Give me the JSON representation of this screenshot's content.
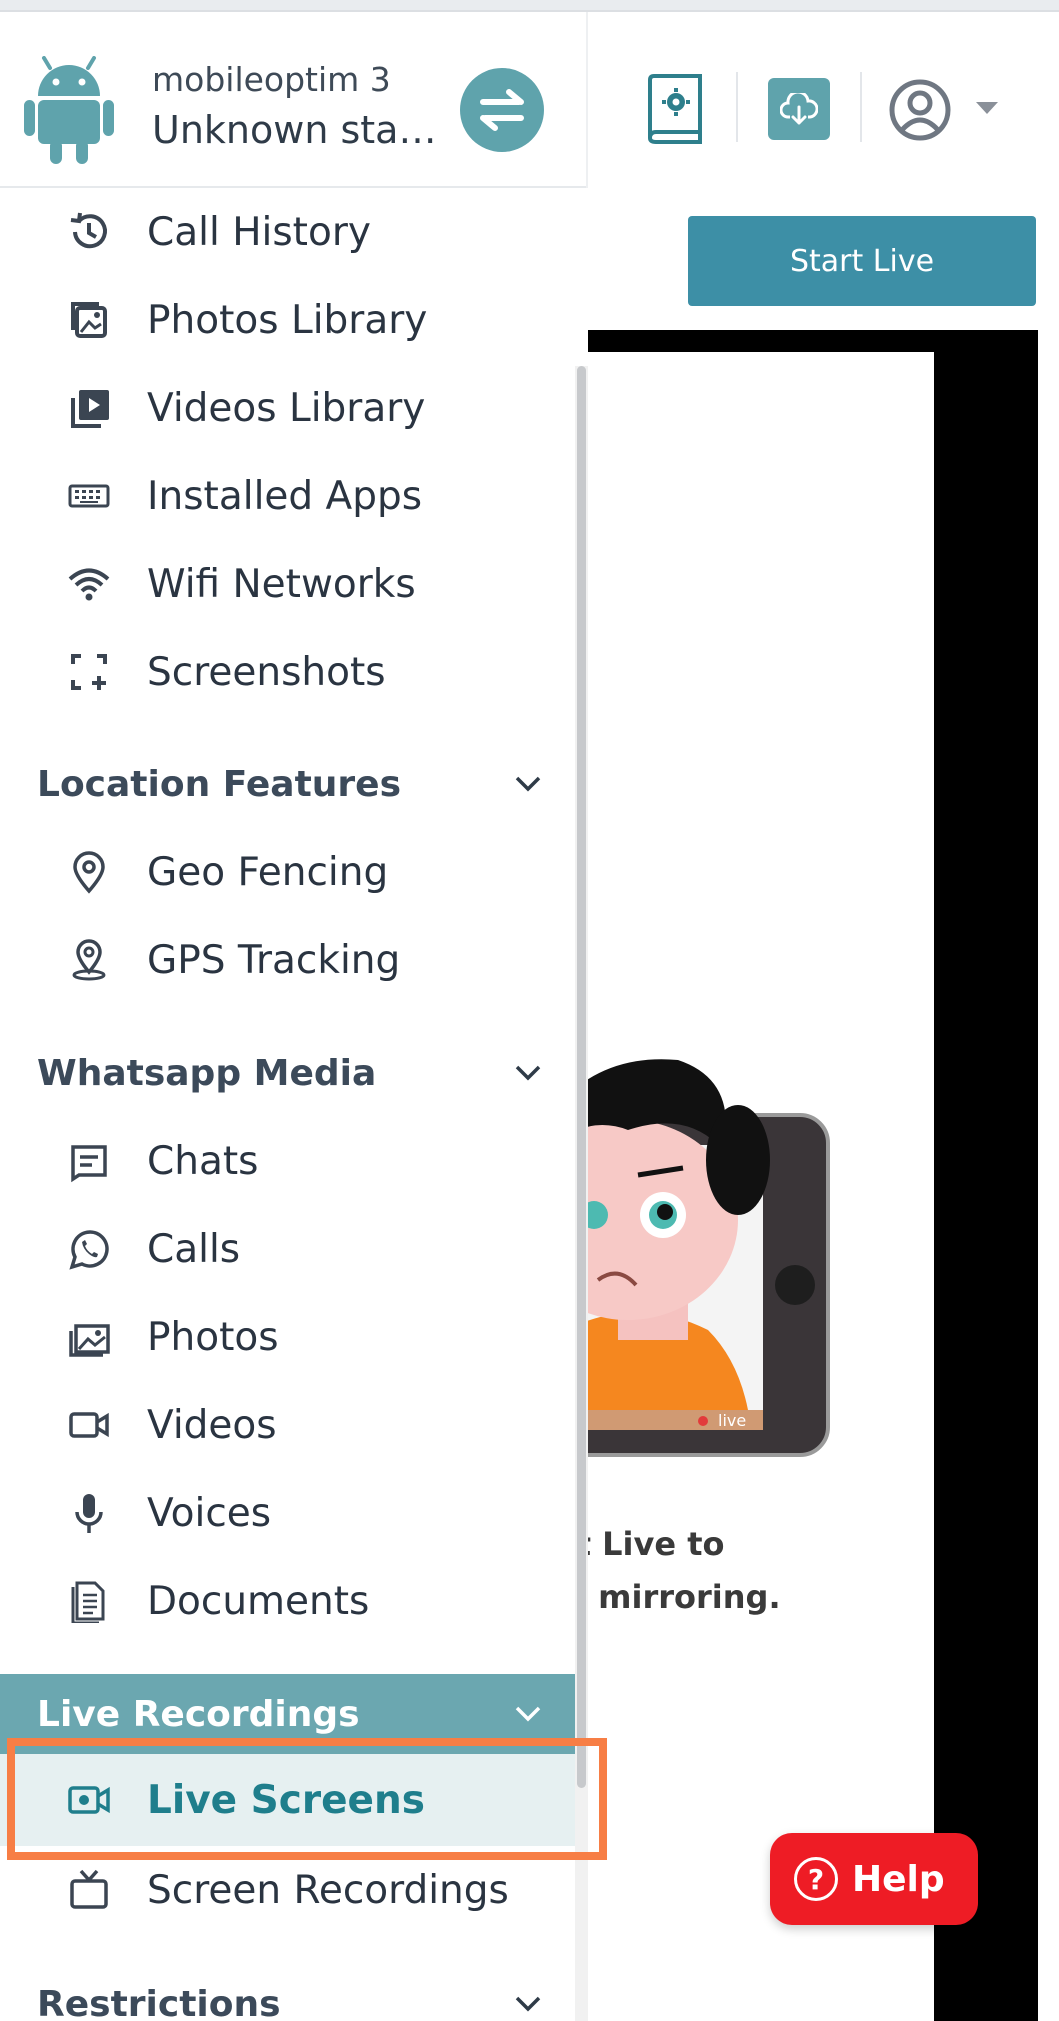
{
  "header": {
    "device_name": "mobileoptim 3",
    "device_status": "Unknown status",
    "icons": {
      "device": "android-icon",
      "switch": "swap-arrows-icon",
      "manual": "settings-book-icon",
      "download": "cloud-download-icon",
      "user": "user-circle-icon",
      "menu": "caret-down-icon"
    }
  },
  "main": {
    "start_live_label": "Start Live",
    "message_line1": "Start Live to",
    "message_line2": "start mirroring.",
    "illustration_badge": "live"
  },
  "help": {
    "label": "Help",
    "icon": "question-circle-icon"
  },
  "sidebar": {
    "items_top": [
      {
        "label": "Call History",
        "icon": "history-icon"
      },
      {
        "label": "Photos Library",
        "icon": "photo-library-icon"
      },
      {
        "label": "Videos Library",
        "icon": "video-library-icon"
      },
      {
        "label": "Installed Apps",
        "icon": "keyboard-icon"
      },
      {
        "label": "Wifi Networks",
        "icon": "wifi-icon"
      },
      {
        "label": "Screenshots",
        "icon": "screenshot-icon"
      }
    ],
    "location": {
      "title": "Location Features",
      "items": [
        {
          "label": "Geo Fencing",
          "icon": "map-pin-icon"
        },
        {
          "label": "GPS Tracking",
          "icon": "location-marker-icon"
        }
      ]
    },
    "whatsapp": {
      "title": "Whatsapp Media",
      "items": [
        {
          "label": "Chats",
          "icon": "chat-icon"
        },
        {
          "label": "Calls",
          "icon": "whatsapp-icon"
        },
        {
          "label": "Photos",
          "icon": "image-icon"
        },
        {
          "label": "Videos",
          "icon": "video-camera-icon"
        },
        {
          "label": "Voices",
          "icon": "microphone-icon"
        },
        {
          "label": "Documents",
          "icon": "document-icon"
        }
      ]
    },
    "live": {
      "title": "Live Recordings",
      "items": [
        {
          "label": "Live Screens",
          "icon": "live-camera-icon",
          "selected": true
        },
        {
          "label": "Screen Recordings",
          "icon": "tv-icon"
        }
      ]
    },
    "restrictions": {
      "title": "Restrictions"
    }
  },
  "colors": {
    "accent": "#5fa3ac",
    "active_section": "#6ba7b0",
    "selected_bg": "#e6f0f1",
    "selected_text": "#1f7e8c",
    "highlight": "#f77e45",
    "start_live": "#3d8fa6",
    "help": "#ee1c25"
  }
}
